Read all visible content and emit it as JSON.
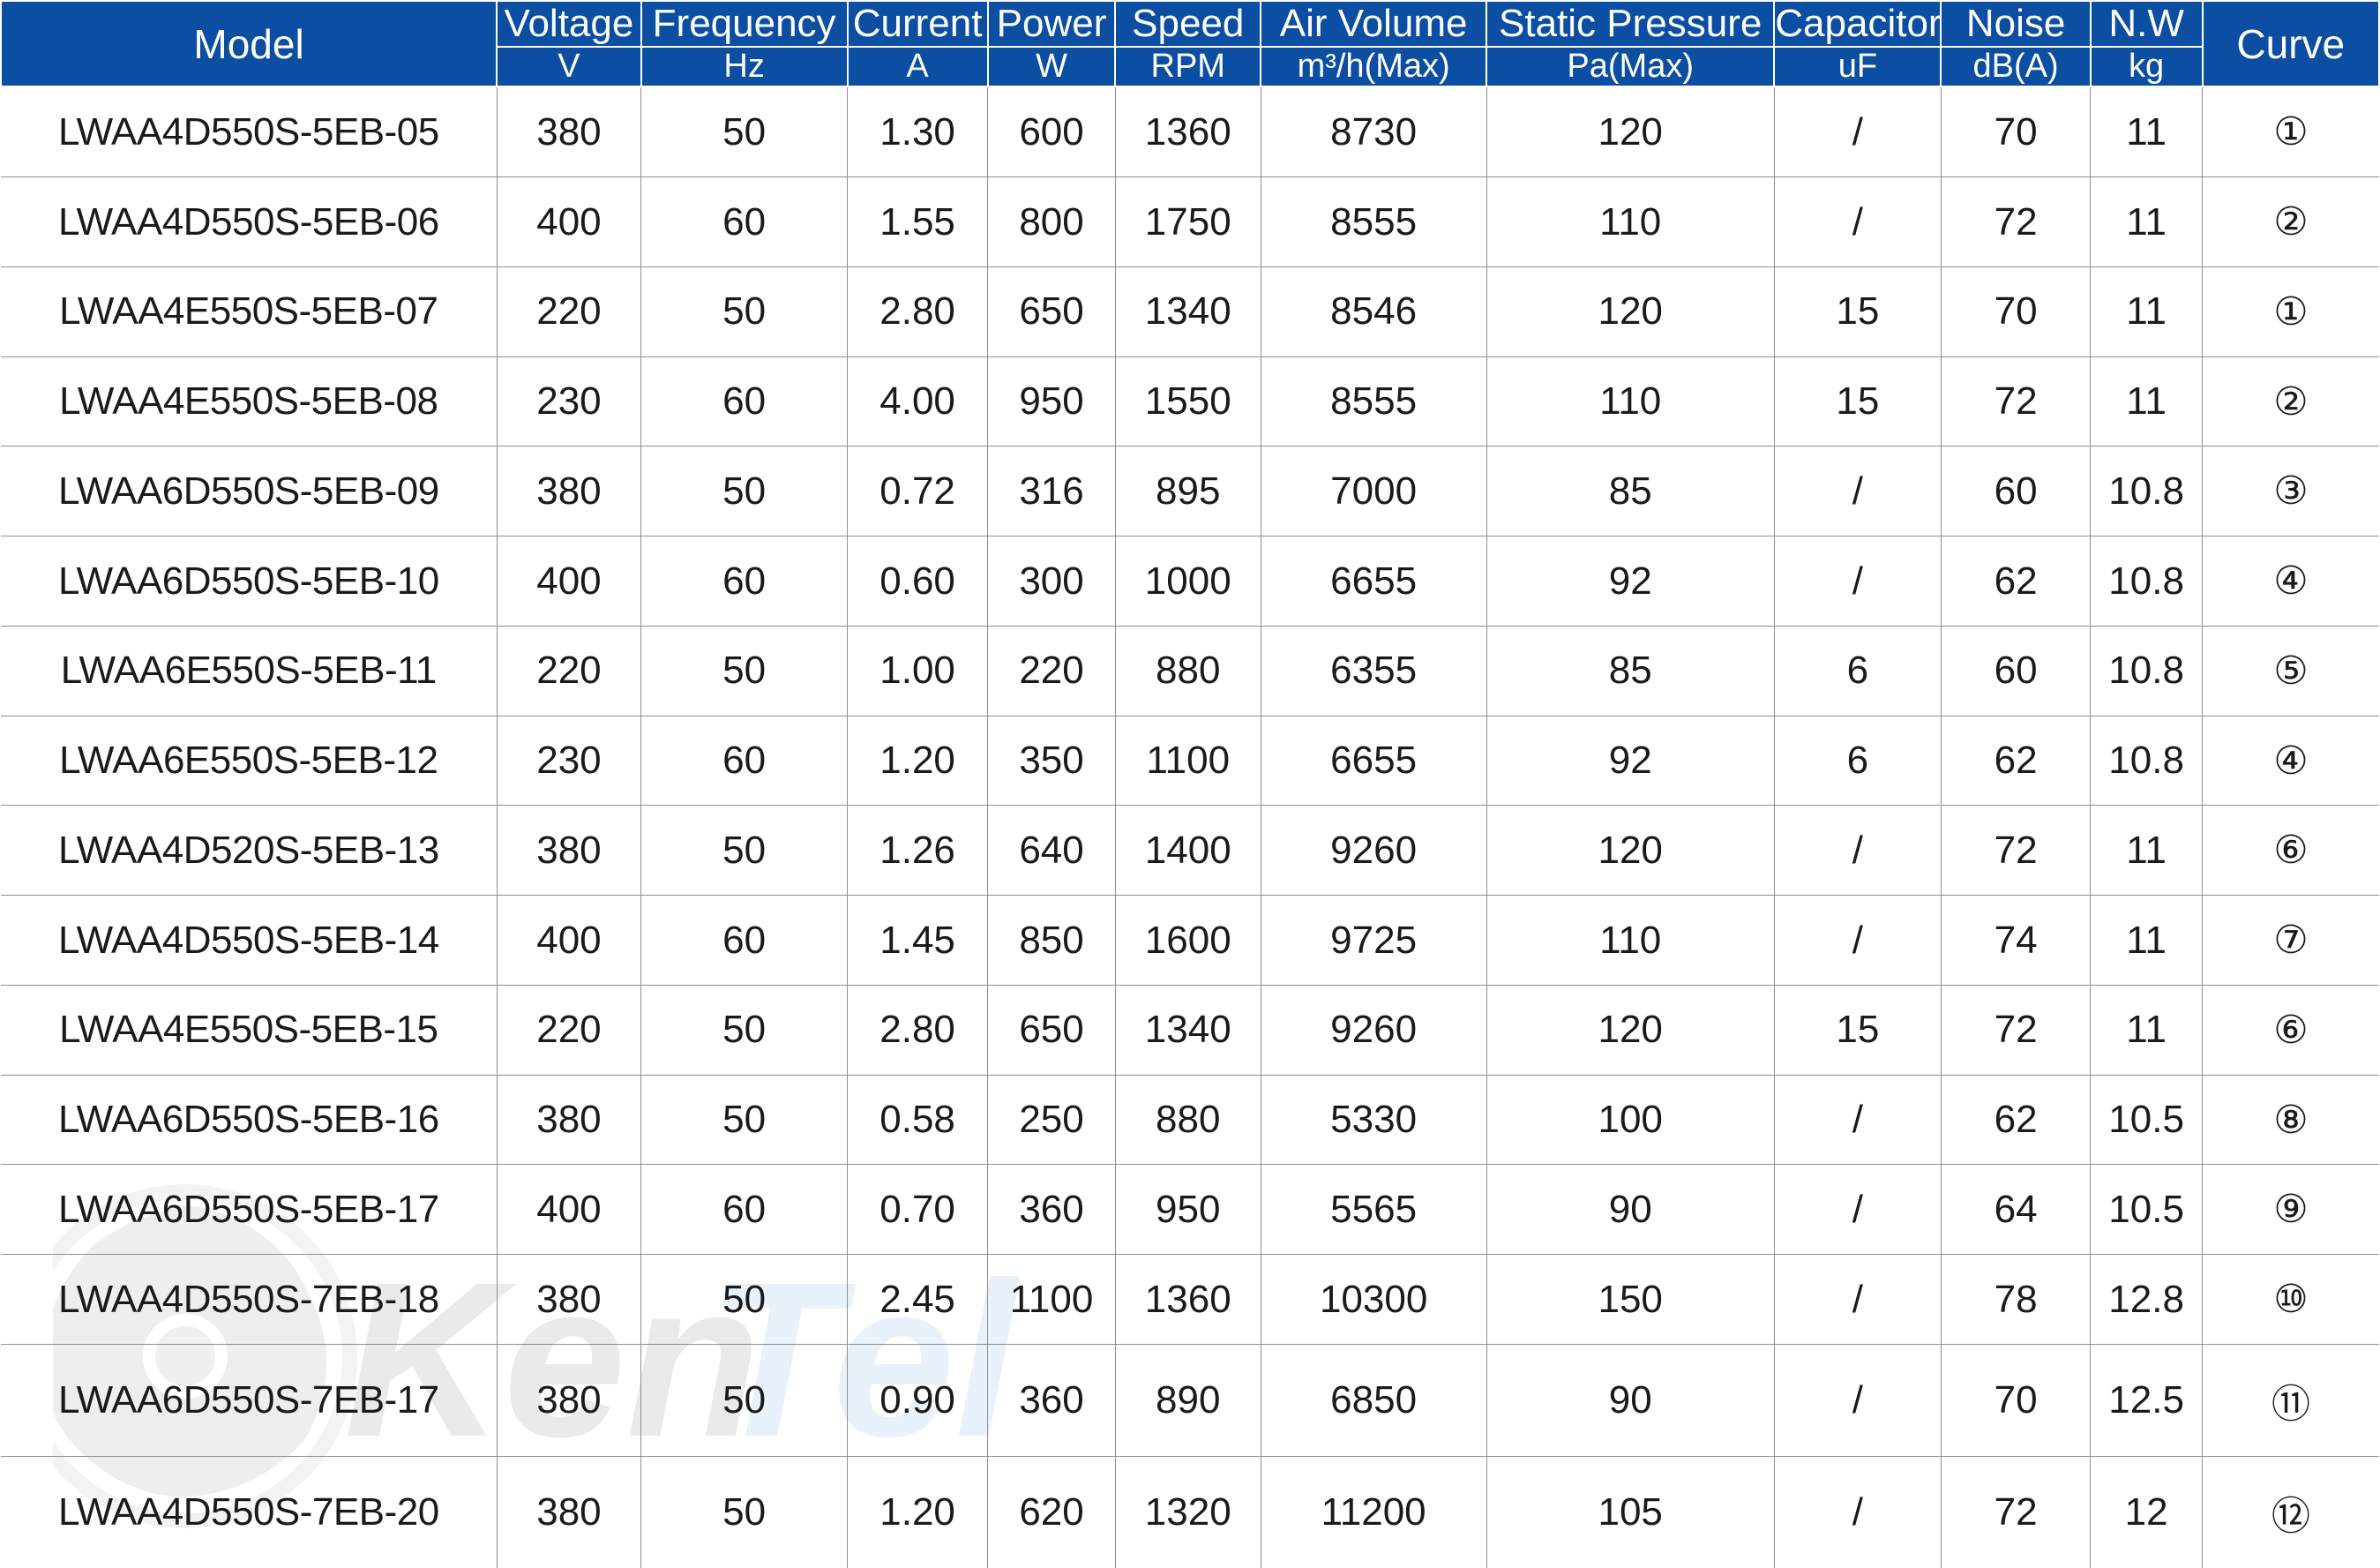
{
  "table": {
    "columns": [
      {
        "key": "model",
        "title": "Model",
        "unit": "",
        "name": "model"
      },
      {
        "key": "voltage",
        "title": "Voltage",
        "unit": "V",
        "name": "voltage"
      },
      {
        "key": "frequency",
        "title": "Frequency",
        "unit": "Hz",
        "name": "frequency"
      },
      {
        "key": "current",
        "title": "Current",
        "unit": "A",
        "name": "current"
      },
      {
        "key": "power",
        "title": "Power",
        "unit": "W",
        "name": "power"
      },
      {
        "key": "speed",
        "title": "Speed",
        "unit": "RPM",
        "name": "speed"
      },
      {
        "key": "air",
        "title": "Air Volume",
        "unit": "m³/h(Max)",
        "name": "air-volume"
      },
      {
        "key": "static",
        "title": "Static Pressure",
        "unit": "Pa(Max)",
        "name": "static-pressure"
      },
      {
        "key": "capacitor",
        "title": "Capacitor",
        "unit": "uF",
        "name": "capacitor"
      },
      {
        "key": "noise",
        "title": "Noise",
        "unit": "dB(A)",
        "name": "noise"
      },
      {
        "key": "nw",
        "title": "N.W",
        "unit": "kg",
        "name": "net-weight"
      },
      {
        "key": "curve",
        "title": "Curve",
        "unit": "",
        "name": "curve"
      }
    ],
    "rows": [
      {
        "model": "LWAA4D550S-5EB-05",
        "voltage": "380",
        "frequency": "50",
        "current": "1.30",
        "power": "600",
        "speed": "1360",
        "air": "8730",
        "static": "120",
        "capacitor": "/",
        "noise": "70",
        "nw": "11",
        "curve": "①"
      },
      {
        "model": "LWAA4D550S-5EB-06",
        "voltage": "400",
        "frequency": "60",
        "current": "1.55",
        "power": "800",
        "speed": "1750",
        "air": "8555",
        "static": "110",
        "capacitor": "/",
        "noise": "72",
        "nw": "11",
        "curve": "②"
      },
      {
        "model": "LWAA4E550S-5EB-07",
        "voltage": "220",
        "frequency": "50",
        "current": "2.80",
        "power": "650",
        "speed": "1340",
        "air": "8546",
        "static": "120",
        "capacitor": "15",
        "noise": "70",
        "nw": "11",
        "curve": "①"
      },
      {
        "model": "LWAA4E550S-5EB-08",
        "voltage": "230",
        "frequency": "60",
        "current": "4.00",
        "power": "950",
        "speed": "1550",
        "air": "8555",
        "static": "110",
        "capacitor": "15",
        "noise": "72",
        "nw": "11",
        "curve": "②"
      },
      {
        "model": "LWAA6D550S-5EB-09",
        "voltage": "380",
        "frequency": "50",
        "current": "0.72",
        "power": "316",
        "speed": "895",
        "air": "7000",
        "static": "85",
        "capacitor": "/",
        "noise": "60",
        "nw": "10.8",
        "curve": "③"
      },
      {
        "model": "LWAA6D550S-5EB-10",
        "voltage": "400",
        "frequency": "60",
        "current": "0.60",
        "power": "300",
        "speed": "1000",
        "air": "6655",
        "static": "92",
        "capacitor": "/",
        "noise": "62",
        "nw": "10.8",
        "curve": "④"
      },
      {
        "model": "LWAA6E550S-5EB-11",
        "voltage": "220",
        "frequency": "50",
        "current": "1.00",
        "power": "220",
        "speed": "880",
        "air": "6355",
        "static": "85",
        "capacitor": "6",
        "noise": "60",
        "nw": "10.8",
        "curve": "⑤"
      },
      {
        "model": "LWAA6E550S-5EB-12",
        "voltage": "230",
        "frequency": "60",
        "current": "1.20",
        "power": "350",
        "speed": "1100",
        "air": "6655",
        "static": "92",
        "capacitor": "6",
        "noise": "62",
        "nw": "10.8",
        "curve": "④"
      },
      {
        "model": "LWAA4D520S-5EB-13",
        "voltage": "380",
        "frequency": "50",
        "current": "1.26",
        "power": "640",
        "speed": "1400",
        "air": "9260",
        "static": "120",
        "capacitor": "/",
        "noise": "72",
        "nw": "11",
        "curve": "⑥"
      },
      {
        "model": "LWAA4D550S-5EB-14",
        "voltage": "400",
        "frequency": "60",
        "current": "1.45",
        "power": "850",
        "speed": "1600",
        "air": "9725",
        "static": "110",
        "capacitor": "/",
        "noise": "74",
        "nw": "11",
        "curve": "⑦"
      },
      {
        "model": "LWAA4E550S-5EB-15",
        "voltage": "220",
        "frequency": "50",
        "current": "2.80",
        "power": "650",
        "speed": "1340",
        "air": "9260",
        "static": "120",
        "capacitor": "15",
        "noise": "72",
        "nw": "11",
        "curve": "⑥"
      },
      {
        "model": "LWAA6D550S-5EB-16",
        "voltage": "380",
        "frequency": "50",
        "current": "0.58",
        "power": "250",
        "speed": "880",
        "air": "5330",
        "static": "100",
        "capacitor": "/",
        "noise": "62",
        "nw": "10.5",
        "curve": "⑧"
      },
      {
        "model": "LWAA6D550S-5EB-17",
        "voltage": "400",
        "frequency": "60",
        "current": "0.70",
        "power": "360",
        "speed": "950",
        "air": "5565",
        "static": "90",
        "capacitor": "/",
        "noise": "64",
        "nw": "10.5",
        "curve": "⑨"
      },
      {
        "model": "LWAA4D550S-7EB-18",
        "voltage": "380",
        "frequency": "50",
        "current": "2.45",
        "power": "1100",
        "speed": "1360",
        "air": "10300",
        "static": "150",
        "capacitor": "/",
        "noise": "78",
        "nw": "12.8",
        "curve": "⑩"
      },
      {
        "model": "LWAA6D550S-7EB-17",
        "voltage": "380",
        "frequency": "50",
        "current": "0.90",
        "power": "360",
        "speed": "890",
        "air": "6850",
        "static": "90",
        "capacitor": "/",
        "noise": "70",
        "nw": "12.5",
        "curve": "⑪"
      },
      {
        "model": "LWAA4D550S-7EB-20",
        "voltage": "380",
        "frequency": "50",
        "current": "1.20",
        "power": "620",
        "speed": "1320",
        "air": "11200",
        "static": "105",
        "capacitor": "/",
        "noise": "72",
        "nw": "12",
        "curve": "⑫"
      }
    ]
  },
  "watermark": {
    "brand_text": "KenTel",
    "icon": "fan-logo-icon",
    "gray_hex": "#bcbcbc",
    "blue_hex": "#b9d4ef"
  },
  "theme": {
    "header_blue_hex": "#0b4ea2",
    "header_text_hex": "#ffffff",
    "body_text_hex": "#1a1a1a",
    "grid_line_hex": "#8e8e8e"
  }
}
